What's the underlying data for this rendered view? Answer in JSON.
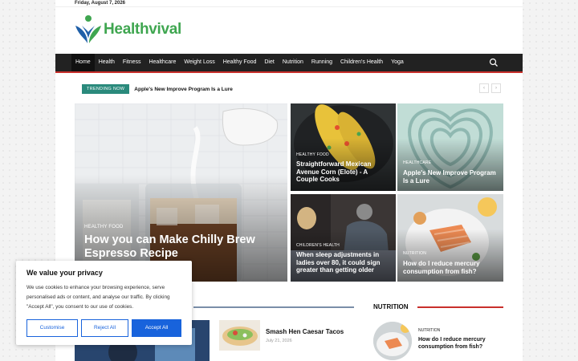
{
  "date": "Friday, August 7, 2026",
  "brand": {
    "name": "Healthvival",
    "color": "#3fa650"
  },
  "nav": {
    "items": [
      "Home",
      "Health",
      "Fitness",
      "Healthcare",
      "Weight Loss",
      "Healthy Food",
      "Diet",
      "Nutrition",
      "Running",
      "Children's Health",
      "Yoga"
    ],
    "search_icon": "search-icon",
    "accent": "#c9302c"
  },
  "trending": {
    "badge": "TRENDING NOW",
    "headline": "Apple's New Improve Program Is a Lure",
    "prev": "‹",
    "next": "›"
  },
  "featured": {
    "main": {
      "category": "HEALTHY FOOD",
      "title": "How you can Make Chilly Brew Espresso Recipe"
    },
    "tiles": [
      {
        "category": "HEALTHY FOOD",
        "title": "Straightforward Mexican Avenue Corn (Elote) - A Couple Cooks"
      },
      {
        "category": "HEALTHCARE",
        "title": "Apple's New Improve Program Is a Lure"
      },
      {
        "category": "CHILDREN'S HEALTH",
        "title": "When sleep adjustments in ladies over 80, it could sign greater than getting older"
      },
      {
        "category": "NUTRITION",
        "title": "How do I reduce mercury consumption from fish?"
      }
    ]
  },
  "sections": {
    "nutrition": {
      "title": "NUTRITION",
      "item": {
        "category": "NUTRITION",
        "title": "How do I reduce mercury consumption from fish?"
      }
    },
    "list": {
      "title": "Smash Hen Caesar Tacos",
      "date": "July 21, 2026"
    }
  },
  "cookie": {
    "title": "We value your privacy",
    "text": "We use cookies to enhance your browsing experience, serve personalised ads or content, and analyse our traffic. By clicking \"Accept All\", you consent to our use of cookies.",
    "customise": "Customise",
    "reject": "Reject All",
    "accept": "Accept All"
  }
}
